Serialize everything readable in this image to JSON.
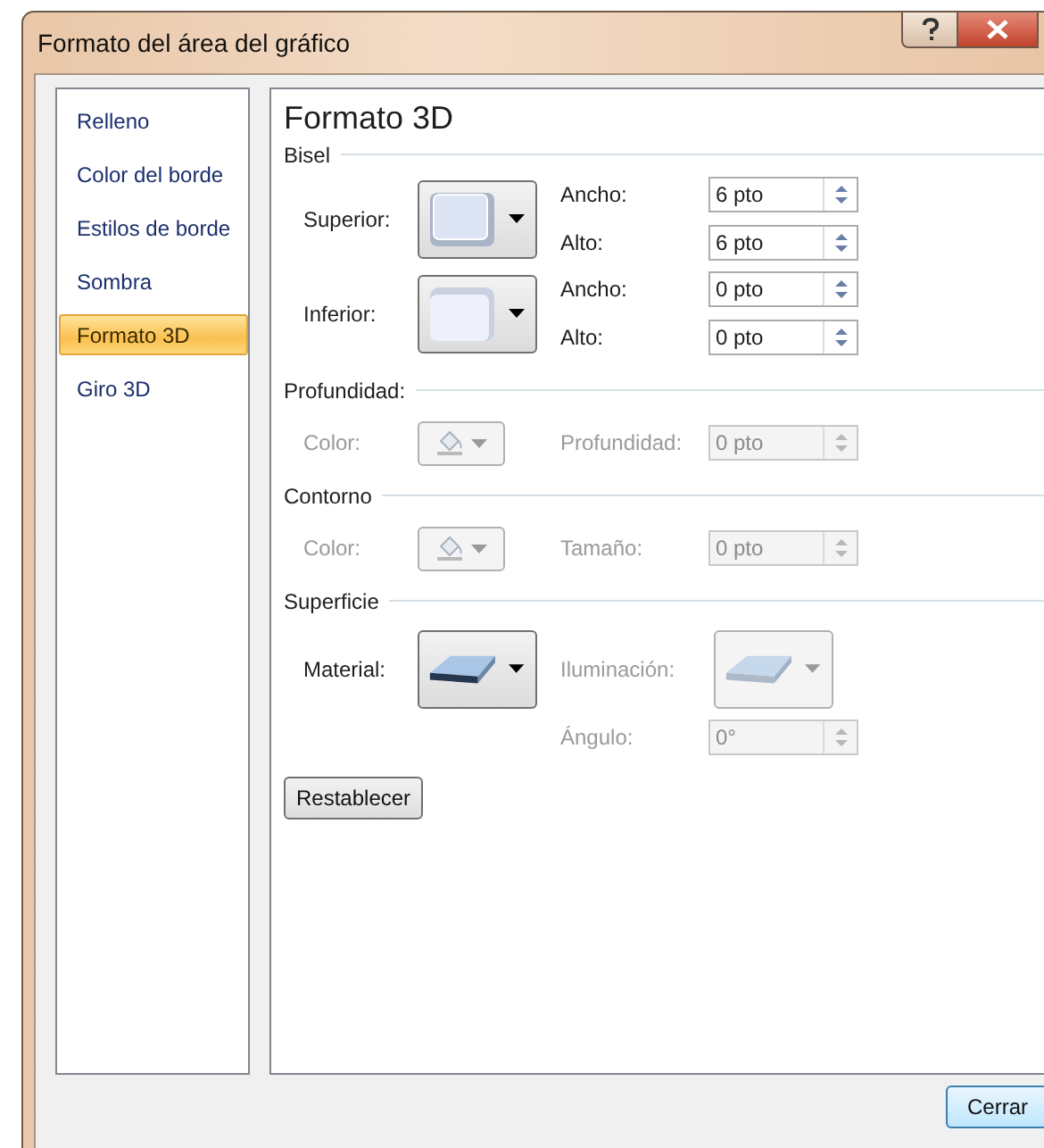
{
  "window": {
    "title": "Formato del área del gráfico"
  },
  "sidebar": {
    "items": [
      {
        "label": "Relleno",
        "selected": false
      },
      {
        "label": "Color del borde",
        "selected": false
      },
      {
        "label": "Estilos de borde",
        "selected": false
      },
      {
        "label": "Sombra",
        "selected": false
      },
      {
        "label": "Formato 3D",
        "selected": true
      },
      {
        "label": "Giro 3D",
        "selected": false
      }
    ]
  },
  "panel": {
    "title": "Formato 3D",
    "bevel": {
      "heading": "Bisel",
      "rows": [
        {
          "label": "Superior:",
          "fields": [
            {
              "label": "Ancho:",
              "value": "6 pto"
            },
            {
              "label": "Alto:",
              "value": "6 pto"
            }
          ]
        },
        {
          "label": "Inferior:",
          "fields": [
            {
              "label": "Ancho:",
              "value": "0 pto"
            },
            {
              "label": "Alto:",
              "value": "0 pto"
            }
          ]
        }
      ]
    },
    "depth": {
      "heading": "Profundidad:",
      "color_label": "Color:",
      "field": {
        "label": "Profundidad:",
        "value": "0 pto"
      },
      "disabled": true
    },
    "contour": {
      "heading": "Contorno",
      "color_label": "Color:",
      "field": {
        "label": "Tamaño:",
        "value": "0 pto"
      },
      "disabled": true
    },
    "surface": {
      "heading": "Superficie",
      "material": {
        "label": "Material:",
        "disabled": false
      },
      "lighting": {
        "label": "Iluminación:",
        "disabled": true
      },
      "angle": {
        "label": "Ángulo:",
        "value": "0°",
        "disabled": true
      }
    },
    "reset_button": "Restablecer"
  },
  "close_button": "Cerrar"
}
